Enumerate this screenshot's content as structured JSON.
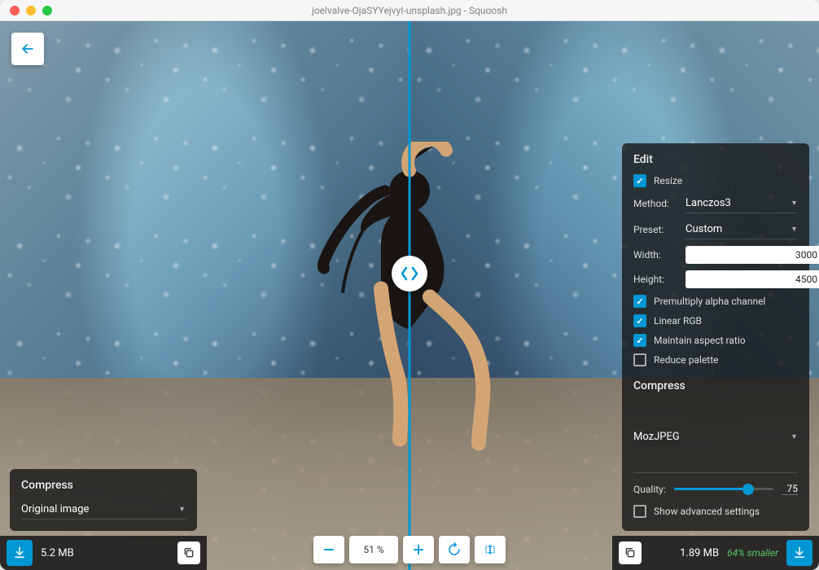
{
  "window": {
    "title": "joelvalve-OjaSYYejvyI-unsplash.jpg - Squoosh"
  },
  "colors": {
    "accent": "#0097d4",
    "success": "#5ac26a"
  },
  "left_panel": {
    "compress_heading": "Compress",
    "format_select": "Original image"
  },
  "right_panel": {
    "edit_heading": "Edit",
    "resize_label": "Resize",
    "method_label": "Method:",
    "method_value": "Lanczos3",
    "preset_label": "Preset:",
    "preset_value": "Custom",
    "width_label": "Width:",
    "width_value": "3000",
    "height_label": "Height:",
    "height_value": "4500",
    "premultiply_label": "Premultiply alpha channel",
    "linear_rgb_label": "Linear RGB",
    "aspect_label": "Maintain aspect ratio",
    "reduce_palette_label": "Reduce palette",
    "compress_heading": "Compress",
    "codec_select": "MozJPEG",
    "quality_label": "Quality:",
    "quality_value": "75",
    "quality_pct": 75,
    "advanced_label": "Show advanced settings"
  },
  "zoom": {
    "value": "51 %"
  },
  "footer": {
    "left_size": "5.2 MB",
    "right_size": "1.89 MB",
    "savings": "64% smaller"
  }
}
